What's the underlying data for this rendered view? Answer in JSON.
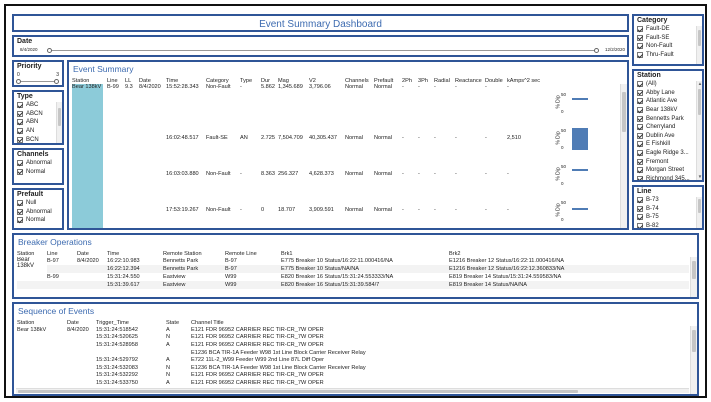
{
  "title": "Event Summary Dashboard",
  "date_filter": {
    "label": "Date",
    "start": "8/4/2020",
    "end": "12/2/2020"
  },
  "priority_filter": {
    "label": "Priority",
    "min": "0",
    "max": "3"
  },
  "type_filter": {
    "label": "Type",
    "items": [
      "ABC",
      "ABCN",
      "ABN",
      "AN",
      "BCN"
    ]
  },
  "channels_filter": {
    "label": "Channels",
    "items": [
      "Abnormal",
      "Normal"
    ]
  },
  "prefault_filter": {
    "label": "Prefault",
    "items": [
      "Null",
      "Abnormal",
      "Normal"
    ]
  },
  "category_filter": {
    "label": "Category",
    "items": [
      "Fault-DE",
      "Fault-SE",
      "Non-Fault",
      "Thru-Fault"
    ]
  },
  "station_filter": {
    "label": "Station",
    "items": [
      "(All)",
      "Abby Lane",
      "Atlantic Ave",
      "Bear 138kV",
      "Bennetts Park",
      "Cherryland",
      "Dublin Ave",
      "E Fishkill",
      "Eagle Ridge 3...",
      "Fremont",
      "Morgan Street",
      "Richmond 345..."
    ]
  },
  "line_filter": {
    "label": "Line",
    "items": [
      "B-73",
      "B-74",
      "B-75",
      "B-82"
    ]
  },
  "event_summary": {
    "title": "Event Summary",
    "columns": [
      "Station",
      "Line",
      "LL",
      "Date",
      "Time",
      "Category",
      "Type",
      "Dur",
      "Mag",
      "V2",
      "Channels",
      "Prefault",
      "2Ph",
      "3Ph",
      "Radial",
      "Reactance",
      "Double",
      "kAmps^2 sec"
    ],
    "station": "Bear 138kV",
    "line": "B-99",
    "ll": "9.3",
    "date": "8/4/2020",
    "rows": [
      {
        "time": "15:52:28.343",
        "category": "Non-Fault",
        "type": "-",
        "dur": "5.862",
        "mag": "1,345.689",
        "v2": "3,796.06",
        "channels": "Normal",
        "prefault": "Normal",
        "ph2": "-",
        "ph3": "-",
        "radial": "-",
        "reactance": "-",
        "double": "-",
        "kamps": "-",
        "bar": 0.45
      },
      {
        "time": "16:02:48.517",
        "category": "Fault-SE",
        "type": "AN",
        "dur": "2.725",
        "mag": "7,504.709",
        "v2": "40,305.437",
        "channels": "Normal",
        "prefault": "Normal",
        "ph2": "-",
        "ph3": "-",
        "radial": "-",
        "reactance": "-",
        "double": "-",
        "kamps": "2,510",
        "bar": 1.0
      },
      {
        "time": "16:03:03.880",
        "category": "Non-Fault",
        "type": "-",
        "dur": "8.363",
        "mag": "256.327",
        "v2": "4,628.373",
        "channels": "Normal",
        "prefault": "Normal",
        "ph2": "-",
        "ph3": "-",
        "radial": "-",
        "reactance": "-",
        "double": "-",
        "kamps": "-",
        "bar": 0.5
      },
      {
        "time": "17:53:19.267",
        "category": "Non-Fault",
        "type": "-",
        "dur": "0",
        "mag": "18.707",
        "v2": "3,909.591",
        "channels": "Normal",
        "prefault": "Normal",
        "ph2": "-",
        "ph3": "-",
        "radial": "-",
        "reactance": "-",
        "double": "-",
        "kamps": "-",
        "bar": 0.4
      }
    ],
    "axis_label": "% Dip",
    "axis_ticks": [
      "50",
      "0"
    ]
  },
  "breaker_operations": {
    "title": "Breaker Operations",
    "columns": [
      "Station",
      "Line",
      "Date",
      "Time",
      "Remote Station",
      "Remote Line",
      "Brk1",
      "Brk2"
    ],
    "station": "Bear 138kV",
    "date": "8/4/2020",
    "rows": [
      {
        "line": "B-97",
        "time": "16:22:10.983",
        "remote_station": "Bennetts Park",
        "remote_line": "B-97",
        "brk1": "E775 Breaker 10 Status/16:22:11.000416/NA",
        "brk2": "E1216 Breaker 12 Status/16:22:11.000416/NA"
      },
      {
        "line": "",
        "time": "16:22:12.394",
        "remote_station": "Bennetts Park",
        "remote_line": "B-97",
        "brk1": "E775 Breaker 10 Status/NA/NA",
        "brk2": "E1216 Breaker 12 Status/16:22:12.360833/NA"
      },
      {
        "line": "B-99",
        "time": "15:31:24.550",
        "remote_station": "Eastview",
        "remote_line": "W99",
        "brk1": "E820 Breaker 16 Status/15:31:24.553333/NA",
        "brk2": "E819 Breaker 14 Status/15:31:24.559583/NA"
      },
      {
        "line": "",
        "time": "15:31:39.617",
        "remote_station": "Eastview",
        "remote_line": "W99",
        "brk1": "E820 Breaker 16 Status/15:31:39.584/7",
        "brk2": "E819 Breaker 14 Status/NA/NA"
      }
    ]
  },
  "sequence_of_events": {
    "title": "Sequence of Events",
    "columns": [
      "Station",
      "Date",
      "Trigger_Time",
      "State",
      "Channel Title"
    ],
    "station": "Bear 138kV",
    "date": "8/4/2020",
    "rows": [
      {
        "time": "15:31:24:518542",
        "state": "A",
        "channel": "E121 FDR 96952 CARRIER REC TIR-CR_7W OPER"
      },
      {
        "time": "15:31:24:520625",
        "state": "N",
        "channel": "E121 FDR 96952 CARRIER REC TIR-CR_7W OPER"
      },
      {
        "time": "15:31:24:528958",
        "state": "A",
        "channel": "E121 FDR 96952 CARRIER REC TIR-CR_7W OPER"
      },
      {
        "time": "",
        "state": "",
        "channel": "E1236 BCA TIR-1A Feeder W98 1st Line Block Carrier Receiver Relay"
      },
      {
        "time": "15:31:24:529792",
        "state": "A",
        "channel": "E722 11L-2_W99 Feeder W99 2nd Line 87L Diff Oper"
      },
      {
        "time": "15:31:24:532083",
        "state": "N",
        "channel": "E1236 BCA TIR-1A Feeder W98 1st Line Block Carrier Receiver Relay"
      },
      {
        "time": "15:31:24:532292",
        "state": "N",
        "channel": "E121 FDR 96952 CARRIER REC TIR-CR_7W OPER"
      },
      {
        "time": "15:31:24:533750",
        "state": "A",
        "channel": "E121 FDR 96952 CARRIER REC TIR-CR_7W OPER"
      }
    ]
  },
  "colors": {
    "accent": "#2f5597",
    "title": "#3d6bb0",
    "station_fill": "#8ccbd9",
    "bar": "#4f7cb5"
  }
}
